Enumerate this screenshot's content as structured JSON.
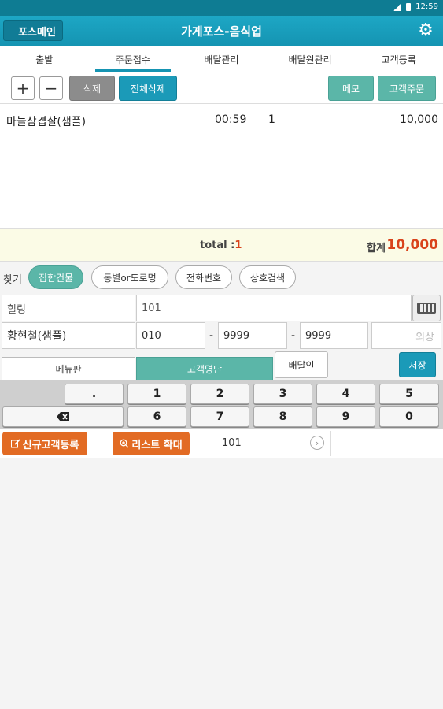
{
  "status": {
    "time": "12:59"
  },
  "appbar": {
    "back_label": "포스메인",
    "title": "가게포스-음식업"
  },
  "tabs": [
    "출발",
    "주문접수",
    "배달관리",
    "배달원관리",
    "고객등록"
  ],
  "toolbar": {
    "plus": "+",
    "minus": "−",
    "delete": "삭제",
    "delete_all": "전체삭제",
    "memo": "메모",
    "customer_order": "고객주문"
  },
  "orders": [
    {
      "name": "마늘삼겹살(샘플)",
      "time": "00:59",
      "qty": "1",
      "price": "10,000"
    }
  ],
  "totals": {
    "total_label": "total :",
    "total_count": "1",
    "sum_label": "합계",
    "sum_value": "10,000"
  },
  "search": {
    "label": "찾기",
    "options": [
      "집합건물",
      "동별or도로명",
      "전화번호",
      "상호검색"
    ],
    "active": "집합건물"
  },
  "customer": {
    "building": "힐링",
    "unit": "101",
    "name": "황현철(샘플)",
    "phone1": "010",
    "phone2": "9999",
    "phone3": "9999",
    "credit_placeholder": "외상",
    "dash": "-"
  },
  "panels": {
    "menu_tab": "메뉴판",
    "customer_list_tab": "고객명단",
    "delivery_person": "배달인",
    "save": "저장"
  },
  "keypad": {
    "row1": [
      ".",
      "1",
      "2",
      "3",
      "4",
      "5"
    ],
    "row2": [
      "6",
      "7",
      "8",
      "9",
      "0"
    ],
    "backspace_icon": "backspace-icon"
  },
  "bottom": {
    "new_customer": "신규고객등록",
    "expand_list": "리스트 확대",
    "selected": "101"
  },
  "colors": {
    "appbar": "#1594b2",
    "teal_button": "#1b9ab8",
    "mint_button": "#5bb6a8",
    "orange_button": "#e26b24",
    "amount_red": "#d9431b"
  }
}
